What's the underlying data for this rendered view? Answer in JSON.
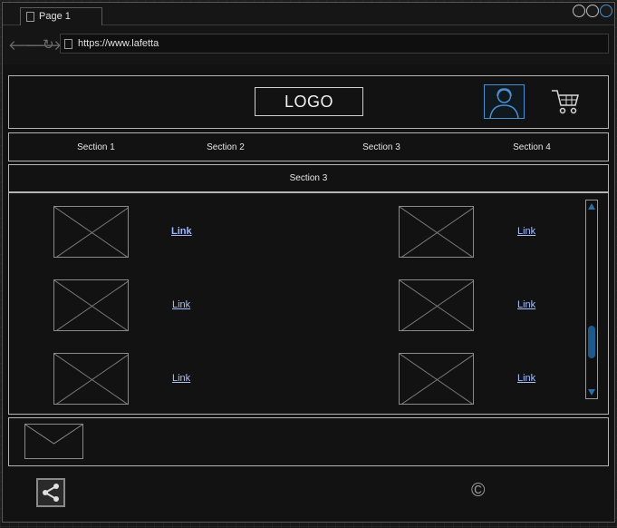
{
  "browser": {
    "tab_label": "Page 1",
    "url": "https://www.lafetta",
    "nav_back": "🡐",
    "nav_forward": "🡒",
    "nav_reload": "↻"
  },
  "header": {
    "logo_text": "LOGO"
  },
  "nav": {
    "items": [
      "Section 1",
      "Section 2",
      "Section 3",
      "Section 4"
    ]
  },
  "subnav": {
    "label": "Section 3"
  },
  "content": {
    "links": [
      "Link",
      "Link",
      "Link",
      "Link",
      "Link",
      "Link"
    ]
  },
  "footer": {
    "copyright_symbol": "©"
  },
  "colors": {
    "accent": "#2a6fa8",
    "link": "#9db8ff",
    "border": "#b4b4b4"
  }
}
